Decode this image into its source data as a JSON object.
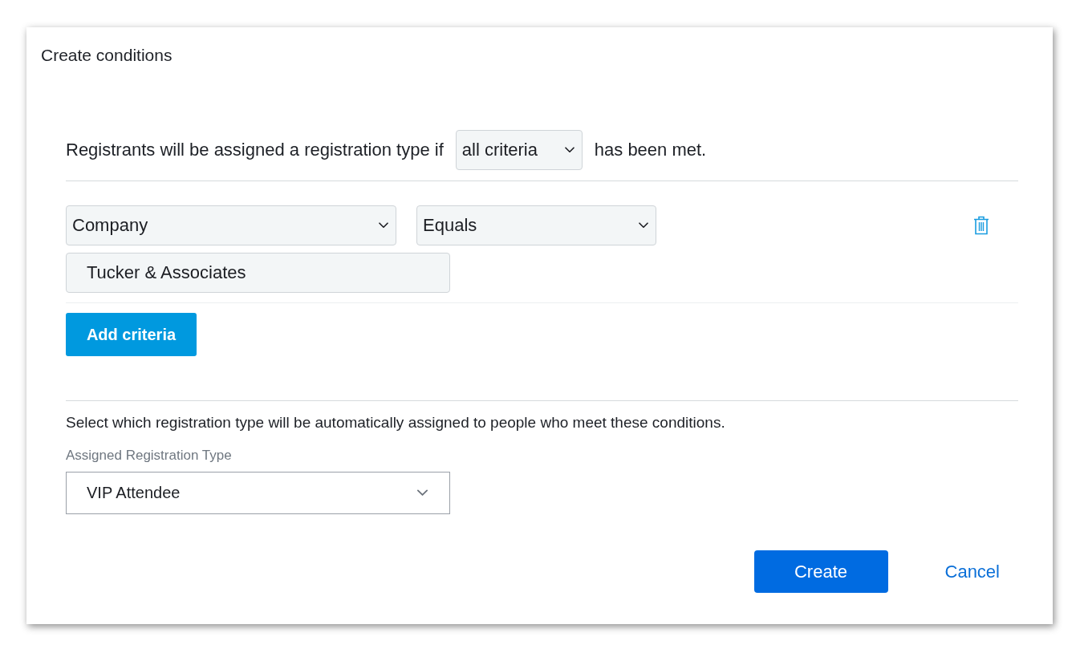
{
  "dialog": {
    "title": "Create conditions"
  },
  "match_rule": {
    "prefix": "Registrants will be assigned a registration type if",
    "selector": "all criteria",
    "suffix": "has been met."
  },
  "criteria": [
    {
      "field": "Company",
      "operator": "Equals",
      "value": "Tucker & Associates"
    }
  ],
  "add_button": "Add criteria",
  "assignment": {
    "description": "Select which registration type will be automatically assigned to people who meet these conditions.",
    "label": "Assigned Registration Type",
    "value": "VIP Attendee"
  },
  "buttons": [
    {
      "label": "Create",
      "kind": "primary"
    },
    {
      "label": "Cancel",
      "kind": "link"
    }
  ]
}
